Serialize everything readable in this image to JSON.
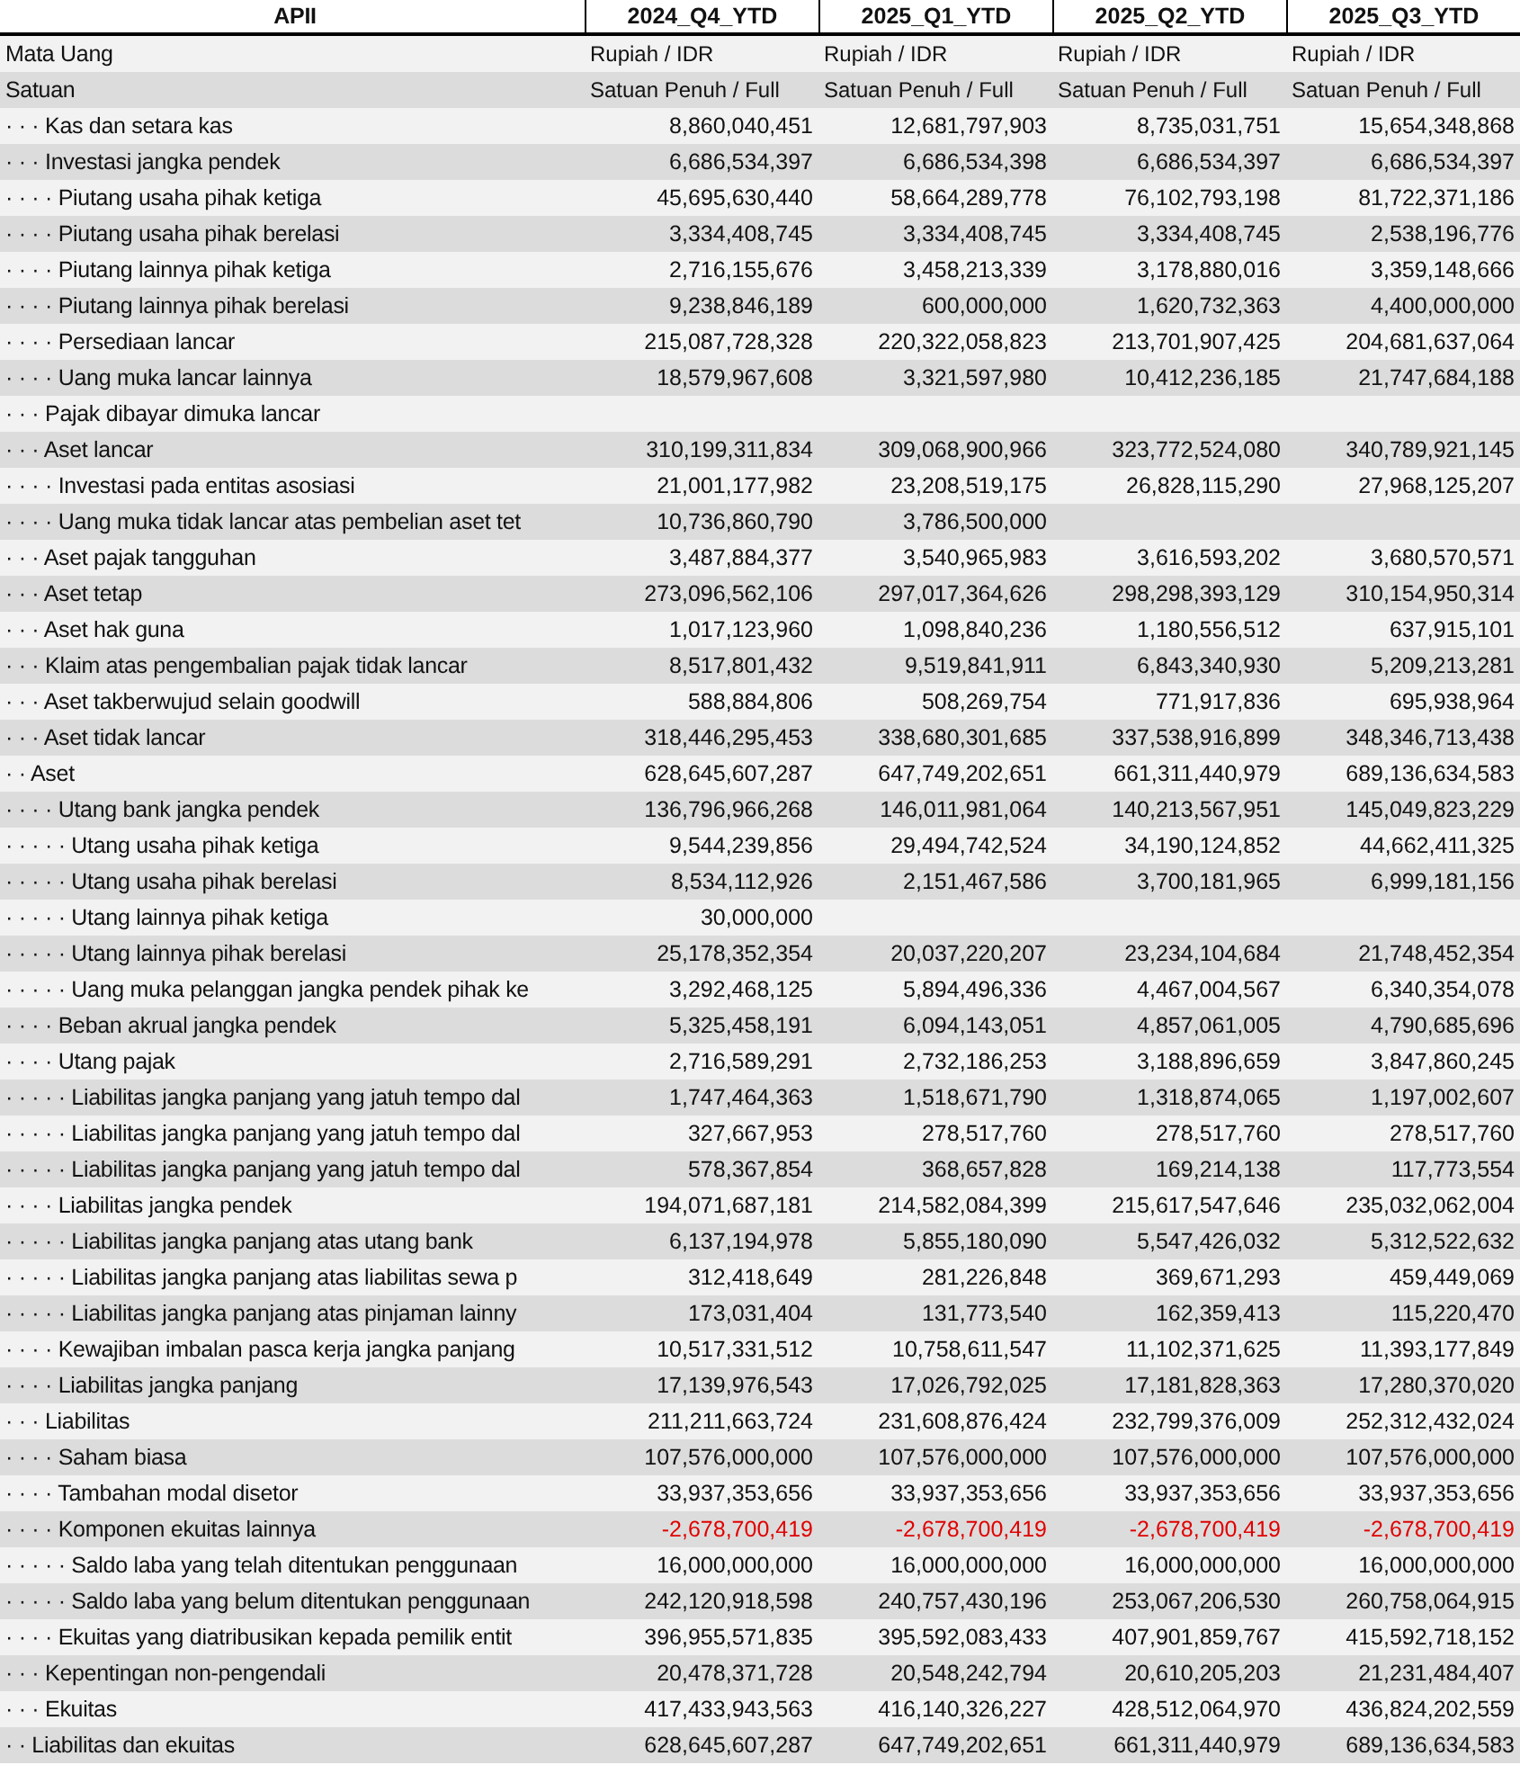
{
  "table": {
    "columns": [
      "APII",
      "2024_Q4_YTD",
      "2025_Q1_YTD",
      "2025_Q2_YTD",
      "2025_Q3_YTD"
    ],
    "meta_rows": [
      {
        "label": "Mata Uang",
        "values": [
          "Rupiah / IDR",
          "Rupiah / IDR",
          "Rupiah / IDR",
          "Rupiah / IDR"
        ]
      },
      {
        "label": "Satuan",
        "values": [
          "Satuan Penuh / Full",
          "Satuan Penuh / Full",
          "Satuan Penuh / Full",
          "Satuan Penuh / Full"
        ]
      }
    ],
    "rows": [
      {
        "label": "· · · Kas dan setara kas",
        "values": [
          "8,860,040,451",
          "12,681,797,903",
          "8,735,031,751",
          "15,654,348,868"
        ],
        "negative": false
      },
      {
        "label": "· · · Investasi jangka pendek",
        "values": [
          "6,686,534,397",
          "6,686,534,398",
          "6,686,534,397",
          "6,686,534,397"
        ],
        "negative": false
      },
      {
        "label": "· · · · Piutang usaha pihak ketiga",
        "values": [
          "45,695,630,440",
          "58,664,289,778",
          "76,102,793,198",
          "81,722,371,186"
        ],
        "negative": false
      },
      {
        "label": "· · · · Piutang usaha pihak berelasi",
        "values": [
          "3,334,408,745",
          "3,334,408,745",
          "3,334,408,745",
          "2,538,196,776"
        ],
        "negative": false
      },
      {
        "label": "· · · · Piutang lainnya pihak ketiga",
        "values": [
          "2,716,155,676",
          "3,458,213,339",
          "3,178,880,016",
          "3,359,148,666"
        ],
        "negative": false
      },
      {
        "label": "· · · · Piutang lainnya pihak berelasi",
        "values": [
          "9,238,846,189",
          "600,000,000",
          "1,620,732,363",
          "4,400,000,000"
        ],
        "negative": false
      },
      {
        "label": "· · · · Persediaan lancar",
        "values": [
          "215,087,728,328",
          "220,322,058,823",
          "213,701,907,425",
          "204,681,637,064"
        ],
        "negative": false
      },
      {
        "label": "· · · · Uang muka lancar lainnya",
        "values": [
          "18,579,967,608",
          "3,321,597,980",
          "10,412,236,185",
          "21,747,684,188"
        ],
        "negative": false
      },
      {
        "label": "· · · Pajak dibayar dimuka lancar",
        "values": []
      },
      {
        "label": "· · · Aset lancar",
        "values": [
          "310,199,311,834",
          "309,068,900,966",
          "323,772,524,080",
          "340,789,921,145"
        ],
        "negative": false
      },
      {
        "label": "· · · · Investasi pada entitas asosiasi",
        "values": [
          "21,001,177,982",
          "23,208,519,175",
          "26,828,115,290",
          "27,968,125,207"
        ],
        "negative": false
      },
      {
        "label": "· · · · Uang muka tidak lancar atas pembelian aset tet",
        "values": [
          "10,736,860,790",
          "3,786,500,000"
        ],
        "negative": false
      },
      {
        "label": "· · · Aset pajak tangguhan",
        "values": [
          "3,487,884,377",
          "3,540,965,983",
          "3,616,593,202",
          "3,680,570,571"
        ],
        "negative": false
      },
      {
        "label": "· · · Aset tetap",
        "values": [
          "273,096,562,106",
          "297,017,364,626",
          "298,298,393,129",
          "310,154,950,314"
        ],
        "negative": false
      },
      {
        "label": "· · · Aset hak guna",
        "values": [
          "1,017,123,960",
          "1,098,840,236",
          "1,180,556,512",
          "637,915,101"
        ],
        "negative": false
      },
      {
        "label": "· · · Klaim atas pengembalian pajak tidak lancar",
        "values": [
          "8,517,801,432",
          "9,519,841,911",
          "6,843,340,930",
          "5,209,213,281"
        ],
        "negative": false
      },
      {
        "label": "· · · Aset takberwujud selain goodwill",
        "values": [
          "588,884,806",
          "508,269,754",
          "771,917,836",
          "695,938,964"
        ],
        "negative": false
      },
      {
        "label": "· · · Aset tidak lancar",
        "values": [
          "318,446,295,453",
          "338,680,301,685",
          "337,538,916,899",
          "348,346,713,438"
        ],
        "negative": false
      },
      {
        "label": "· · Aset",
        "values": [
          "628,645,607,287",
          "647,749,202,651",
          "661,311,440,979",
          "689,136,634,583"
        ],
        "negative": false
      },
      {
        "label": "· · · · Utang bank jangka pendek",
        "values": [
          "136,796,966,268",
          "146,011,981,064",
          "140,213,567,951",
          "145,049,823,229"
        ],
        "negative": false
      },
      {
        "label": "· · · · · Utang usaha pihak ketiga",
        "values": [
          "9,544,239,856",
          "29,494,742,524",
          "34,190,124,852",
          "44,662,411,325"
        ],
        "negative": false
      },
      {
        "label": "· · · · · Utang usaha pihak berelasi",
        "values": [
          "8,534,112,926",
          "2,151,467,586",
          "3,700,181,965",
          "6,999,181,156"
        ],
        "negative": false
      },
      {
        "label": "· · · · · Utang lainnya pihak ketiga",
        "values": [
          "30,000,000"
        ],
        "negative": false
      },
      {
        "label": "· · · · · Utang lainnya pihak berelasi",
        "values": [
          "25,178,352,354",
          "20,037,220,207",
          "23,234,104,684",
          "21,748,452,354"
        ],
        "negative": false
      },
      {
        "label": "· · · · · Uang muka pelanggan jangka pendek pihak ke",
        "values": [
          "3,292,468,125",
          "5,894,496,336",
          "4,467,004,567",
          "6,340,354,078"
        ],
        "negative": false
      },
      {
        "label": "· · · · Beban akrual jangka pendek",
        "values": [
          "5,325,458,191",
          "6,094,143,051",
          "4,857,061,005",
          "4,790,685,696"
        ],
        "negative": false
      },
      {
        "label": "· · · · Utang pajak",
        "values": [
          "2,716,589,291",
          "2,732,186,253",
          "3,188,896,659",
          "3,847,860,245"
        ],
        "negative": false
      },
      {
        "label": "· · · · · Liabilitas jangka panjang yang jatuh tempo dal",
        "values": [
          "1,747,464,363",
          "1,518,671,790",
          "1,318,874,065",
          "1,197,002,607"
        ],
        "negative": false
      },
      {
        "label": "· · · · · Liabilitas jangka panjang yang jatuh tempo dal",
        "values": [
          "327,667,953",
          "278,517,760",
          "278,517,760",
          "278,517,760"
        ],
        "negative": false
      },
      {
        "label": "· · · · · Liabilitas jangka panjang yang jatuh tempo dal",
        "values": [
          "578,367,854",
          "368,657,828",
          "169,214,138",
          "117,773,554"
        ],
        "negative": false
      },
      {
        "label": "· · · · Liabilitas jangka pendek",
        "values": [
          "194,071,687,181",
          "214,582,084,399",
          "215,617,547,646",
          "235,032,062,004"
        ],
        "negative": false
      },
      {
        "label": "· · · · · Liabilitas jangka panjang atas utang bank",
        "values": [
          "6,137,194,978",
          "5,855,180,090",
          "5,547,426,032",
          "5,312,522,632"
        ],
        "negative": false
      },
      {
        "label": "· · · · · Liabilitas jangka panjang atas liabilitas sewa p",
        "values": [
          "312,418,649",
          "281,226,848",
          "369,671,293",
          "459,449,069"
        ],
        "negative": false
      },
      {
        "label": "· · · · · Liabilitas jangka panjang atas pinjaman lainny",
        "values": [
          "173,031,404",
          "131,773,540",
          "162,359,413",
          "115,220,470"
        ],
        "negative": false
      },
      {
        "label": "· · · · Kewajiban imbalan pasca kerja jangka panjang",
        "values": [
          "10,517,331,512",
          "10,758,611,547",
          "11,102,371,625",
          "11,393,177,849"
        ],
        "negative": false
      },
      {
        "label": "· · · · Liabilitas jangka panjang",
        "values": [
          "17,139,976,543",
          "17,026,792,025",
          "17,181,828,363",
          "17,280,370,020"
        ],
        "negative": false
      },
      {
        "label": "· · · Liabilitas",
        "values": [
          "211,211,663,724",
          "231,608,876,424",
          "232,799,376,009",
          "252,312,432,024"
        ],
        "negative": false
      },
      {
        "label": "· · · · Saham biasa",
        "values": [
          "107,576,000,000",
          "107,576,000,000",
          "107,576,000,000",
          "107,576,000,000"
        ],
        "negative": false
      },
      {
        "label": "· · · · Tambahan modal disetor",
        "values": [
          "33,937,353,656",
          "33,937,353,656",
          "33,937,353,656",
          "33,937,353,656"
        ],
        "negative": false
      },
      {
        "label": "· · · · Komponen ekuitas lainnya",
        "values": [
          "-2,678,700,419",
          "-2,678,700,419",
          "-2,678,700,419",
          "-2,678,700,419"
        ],
        "negative": true
      },
      {
        "label": "· · · · · Saldo laba yang telah ditentukan penggunaan",
        "values": [
          "16,000,000,000",
          "16,000,000,000",
          "16,000,000,000",
          "16,000,000,000"
        ],
        "negative": false
      },
      {
        "label": "· · · · · Saldo laba yang belum ditentukan penggunaan",
        "values": [
          "242,120,918,598",
          "240,757,430,196",
          "253,067,206,530",
          "260,758,064,915"
        ],
        "negative": false
      },
      {
        "label": "· · · · Ekuitas yang diatribusikan kepada pemilik entit",
        "values": [
          "396,955,571,835",
          "395,592,083,433",
          "407,901,859,767",
          "415,592,718,152"
        ],
        "negative": false
      },
      {
        "label": "· · · Kepentingan non-pengendali",
        "values": [
          "20,478,371,728",
          "20,548,242,794",
          "20,610,205,203",
          "21,231,484,407"
        ],
        "negative": false
      },
      {
        "label": "· · · Ekuitas",
        "values": [
          "417,433,943,563",
          "416,140,326,227",
          "428,512,064,970",
          "436,824,202,559"
        ],
        "negative": false
      },
      {
        "label": "· · Liabilitas dan ekuitas",
        "values": [
          "628,645,607,287",
          "647,749,202,651",
          "661,311,440,979",
          "689,136,634,583"
        ],
        "negative": false
      }
    ]
  }
}
